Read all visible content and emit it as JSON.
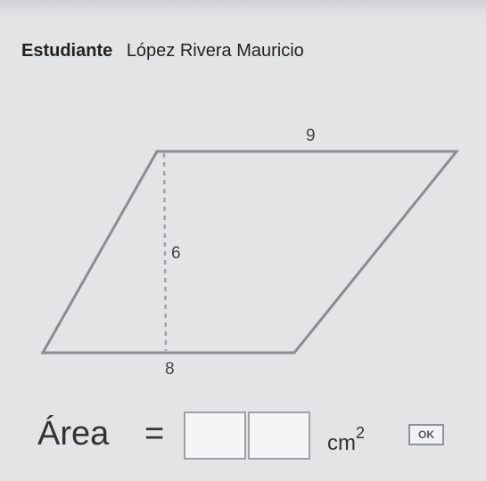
{
  "header": {
    "student_label": "Estudiante",
    "student_name": "López Rivera Mauricio"
  },
  "figure": {
    "shape": "parallelogram",
    "base_label_top": "9",
    "height_label": "6",
    "base_label_bottom": "8"
  },
  "answer": {
    "label": "Área",
    "equals": "=",
    "input_values": [
      "",
      ""
    ],
    "unit": "cm",
    "unit_exponent": "2",
    "ok_label": "OK"
  },
  "colors": {
    "background": "#e3e4e6",
    "stroke": "#8a8d90"
  }
}
